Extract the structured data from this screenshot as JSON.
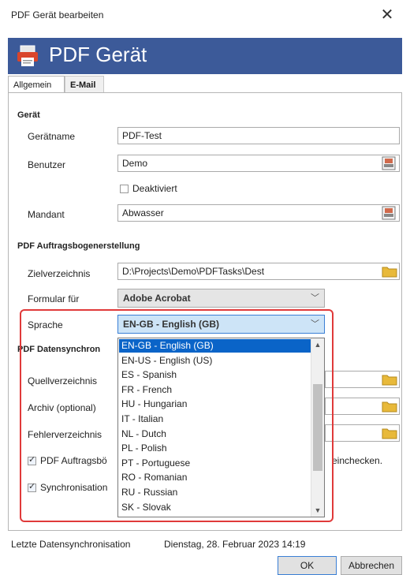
{
  "window": {
    "title": "PDF Gerät bearbeiten",
    "close_glyph": "✕"
  },
  "banner": {
    "title": "PDF Gerät",
    "color": "#3c5a99"
  },
  "tabs": [
    {
      "label": "Allgemein",
      "active": true
    },
    {
      "label": "E-Mail",
      "active": false
    }
  ],
  "geraet": {
    "section_title": "Gerät",
    "name_label": "Gerätname",
    "name_value": "PDF-Test",
    "user_label": "Benutzer",
    "user_value": "Demo",
    "deactivated_label": "Deaktiviert",
    "deactivated_checked": false,
    "mandant_label": "Mandant",
    "mandant_value": "Abwasser"
  },
  "auftrag": {
    "section_title": "PDF Auftragsbogenerstellung",
    "target_dir_label": "Zielverzeichnis",
    "target_dir_value": "D:\\Projects\\Demo\\PDFTasks\\Dest",
    "form_for_label": "Formular für",
    "form_for_value": "Adobe Acrobat",
    "language_label": "Sprache",
    "language_value": "EN-GB - English (GB)"
  },
  "sync": {
    "section_title": "PDF Datensynchron",
    "source_label": "Quellverzeichnis",
    "archive_label": "Archiv (optional)",
    "error_label": "Fehlerverzeichnis",
    "checkbox1_label": "PDF Auftragsbö",
    "checkbox1_suffix": "einchecken.",
    "checkbox1_checked": true,
    "checkbox2_label": "Synchronisation",
    "checkbox2_checked": true
  },
  "language_options": [
    "EN-GB - English (GB)",
    "EN-US - English (US)",
    "ES - Spanish",
    "FR - French",
    "HU - Hungarian",
    "IT - Italian",
    "NL - Dutch",
    "PL - Polish",
    "PT - Portuguese",
    "RO - Romanian",
    "RU - Russian",
    "SK - Slovak"
  ],
  "selected_language_index": 0,
  "footer": {
    "last_sync_label": "Letzte Datensynchronisation",
    "last_sync_value": "Dienstag, 28. Februar 2023 14:19"
  },
  "buttons": {
    "ok": "OK",
    "cancel": "Abbrechen"
  },
  "colors": {
    "accent": "#0a64c8",
    "highlight_border": "#e03a3a"
  },
  "icons": {
    "banner": "printer-pdf-icon",
    "picker": "user-picker-icon",
    "folder": "folder-icon",
    "chevron": "chevron-down-icon"
  }
}
